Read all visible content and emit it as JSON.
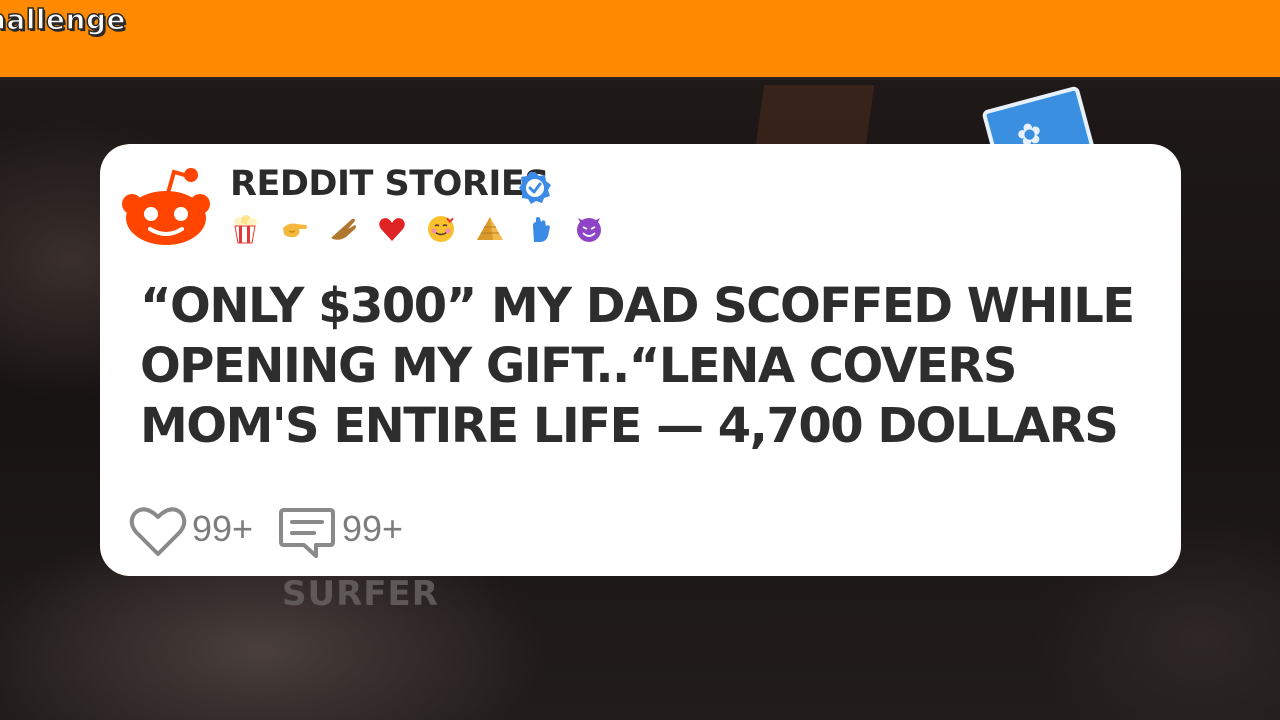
{
  "top_bar": {
    "title": "hallenge",
    "color": "#ff8a00"
  },
  "background": {
    "overlay_text": "SURFER"
  },
  "post": {
    "channel_name": "REDDIT STORIES",
    "verified": true,
    "logo_icon": "reddit-alien-icon",
    "logo_color": "#ff4500",
    "emojis": [
      "popcorn",
      "pointing-hand",
      "hand",
      "red-heart",
      "smiling-face-with-hearts",
      "pyramid",
      "raised-back-of-hand",
      "smiling-face-with-horns"
    ],
    "headline": "“ONLY $300” MY DAD SCOFFED WHILE OPENING MY GIFT..“LENA COVERS MOM'S ENTIRE LIFE — 4,700 DOLLARS",
    "likes": "99+",
    "comments": "99+"
  }
}
